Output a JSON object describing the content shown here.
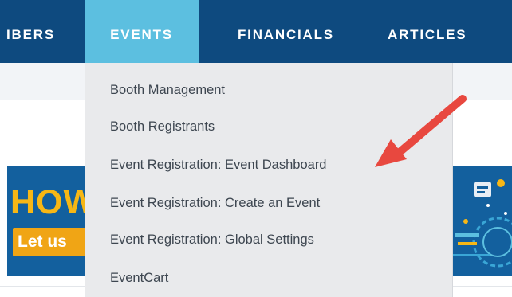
{
  "nav": {
    "items": [
      {
        "label": "IBERS"
      },
      {
        "label": "EVENTS"
      },
      {
        "label": "FINANCIALS"
      },
      {
        "label": "ARTICLES"
      }
    ]
  },
  "banner": {
    "title": "HOW",
    "cta": "Let us"
  },
  "dropdown": {
    "items": [
      {
        "label": "Booth Management"
      },
      {
        "label": "Booth Registrants"
      },
      {
        "label": "Event Registration: Event Dashboard"
      },
      {
        "label": "Event Registration: Create an Event"
      },
      {
        "label": "Event Registration: Global Settings"
      },
      {
        "label": "EventCart"
      }
    ]
  },
  "colors": {
    "nav_bg": "#0e4a7f",
    "nav_active_bg": "#5cbfe0",
    "dropdown_bg": "#e9eaec",
    "annotation_arrow": "#e8483f",
    "banner_accent": "#f7b715"
  },
  "annotation": {
    "icon": "red-arrow-icon"
  }
}
